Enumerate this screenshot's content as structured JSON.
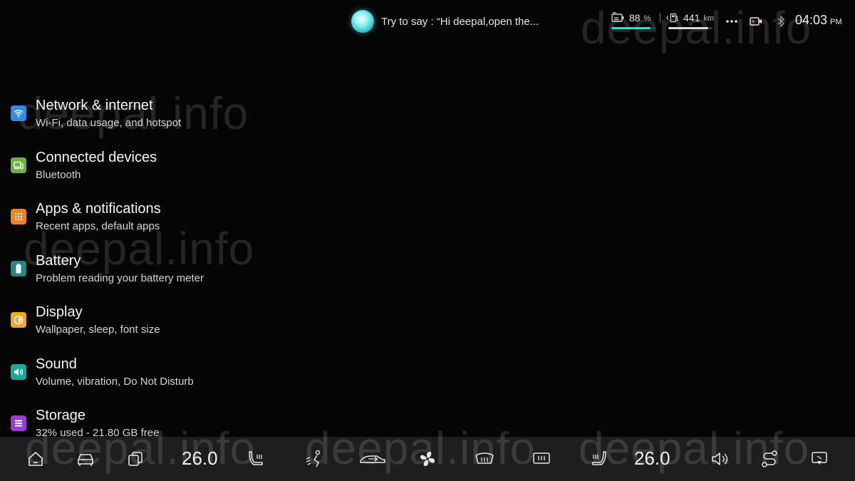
{
  "status_bar": {
    "assistant_hint": "Try to say : “Hi deepal,open the...",
    "battery_value": "88",
    "battery_unit": "%",
    "battery_level": 0.88,
    "range_value": "441",
    "range_unit": "km",
    "range_level": 0.9,
    "time": "04:03",
    "ampm": "PM",
    "accent_color": "#3fd6c5"
  },
  "watermark": "deepal.info",
  "settings": [
    {
      "title": "Network & internet",
      "summary": "Wi-Fi, data usage, and hotspot",
      "icon": "wifi-icon",
      "color": "#2f8be6"
    },
    {
      "title": "Connected devices",
      "summary": "Bluetooth",
      "icon": "devices-icon",
      "color": "#6cb33e"
    },
    {
      "title": "Apps & notifications",
      "summary": "Recent apps, default apps",
      "icon": "apps-grid-icon",
      "color": "#f4821f"
    },
    {
      "title": "Battery",
      "summary": "Problem reading your battery meter",
      "icon": "battery-icon",
      "color": "#23897e"
    },
    {
      "title": "Display",
      "summary": "Wallpaper, sleep, font size",
      "icon": "brightness-icon",
      "color": "#f5a623"
    },
    {
      "title": "Sound",
      "summary": "Volume, vibration, Do Not Disturb",
      "icon": "volume-icon",
      "color": "#1aa89c"
    },
    {
      "title": "Storage",
      "summary": "32% used - 21.80 GB free",
      "icon": "storage-icon",
      "color": "#9b3bd4"
    }
  ],
  "climate": {
    "left_temp": "26.0",
    "right_temp": "26.0"
  }
}
